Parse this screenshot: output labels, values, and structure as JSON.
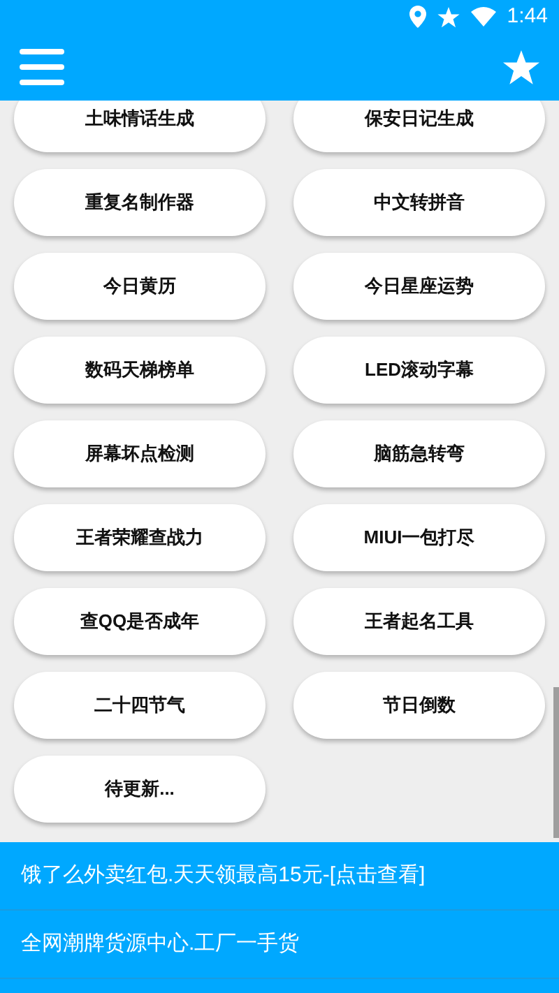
{
  "status_bar": {
    "time": "1:44"
  },
  "tools": [
    {
      "label": "土味情话生成"
    },
    {
      "label": "保安日记生成"
    },
    {
      "label": "重复名制作器"
    },
    {
      "label": "中文转拼音"
    },
    {
      "label": "今日黄历"
    },
    {
      "label": "今日星座运势"
    },
    {
      "label": "数码天梯榜单"
    },
    {
      "label": "LED滚动字幕"
    },
    {
      "label": "屏幕坏点检测"
    },
    {
      "label": "脑筋急转弯"
    },
    {
      "label": "王者荣耀查战力"
    },
    {
      "label": "MIUI一包打尽"
    },
    {
      "label": "查QQ是否成年"
    },
    {
      "label": "王者起名工具"
    },
    {
      "label": "二十四节气"
    },
    {
      "label": "节日倒数"
    },
    {
      "label": "待更新..."
    }
  ],
  "banners": [
    {
      "text": "饿了么外卖红包.天天领最高15元-[点击查看]"
    },
    {
      "text": "全网潮牌货源中心.工厂一手货"
    }
  ]
}
